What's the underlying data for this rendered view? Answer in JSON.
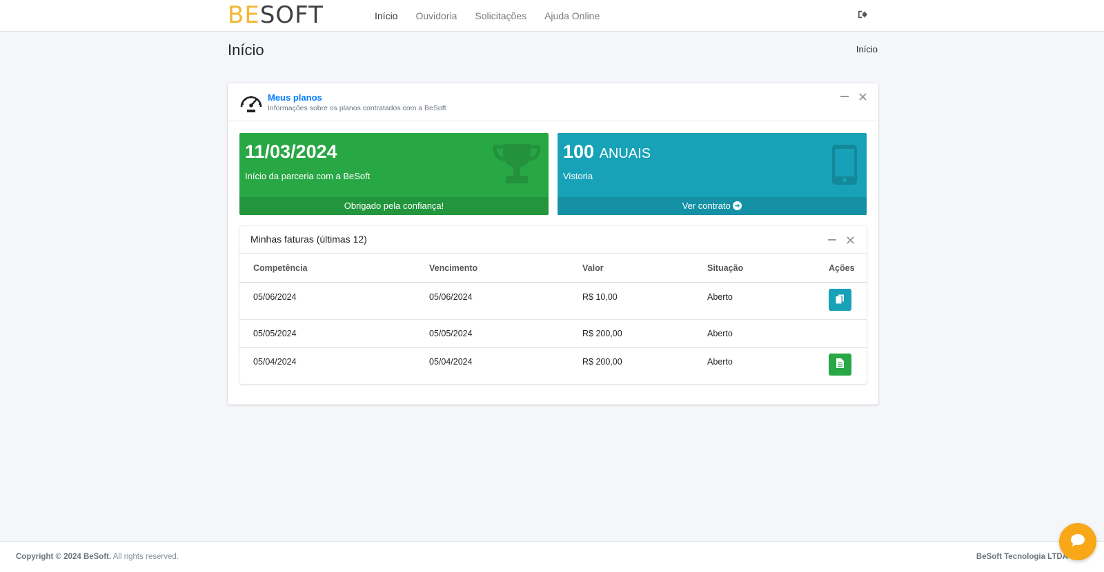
{
  "brand": {
    "logo_part1": "BE",
    "logo_part2": "SOFT"
  },
  "nav": {
    "items": [
      {
        "label": "Início",
        "active": true
      },
      {
        "label": "Ouvidoria",
        "active": false
      },
      {
        "label": "Solicitações",
        "active": false
      },
      {
        "label": "Ajuda Online",
        "active": false
      }
    ],
    "logout_icon": "sign-out-icon"
  },
  "header": {
    "title": "Início",
    "breadcrumb": "Início"
  },
  "plans_card": {
    "title": "Meus planos",
    "subtitle": "Informações sobre os planos contratados com a BeSoft",
    "icon": "speedometer-icon"
  },
  "boxes": {
    "start": {
      "value": "11/03/2024",
      "description": "Início da parceria com a BeSoft",
      "footer": "Obrigado pela confiança!",
      "icon": "trophy-icon",
      "color": "#28a745"
    },
    "plan": {
      "value": "100",
      "value_suffix": "ANUAIS",
      "description": "Vistoria",
      "footer": "Ver contrato",
      "icon": "mobile-icon",
      "color": "#17a2b8"
    }
  },
  "invoices": {
    "title": "Minhas faturas (últimas 12)",
    "columns": [
      "Competência",
      "Vencimento",
      "Valor",
      "Situação",
      "Ações"
    ],
    "rows": [
      {
        "competencia": "05/06/2024",
        "vencimento": "05/06/2024",
        "valor": "R$ 10,00",
        "situacao": "Aberto",
        "action": "copy-icon"
      },
      {
        "competencia": "05/05/2024",
        "vencimento": "05/05/2024",
        "valor": "R$ 200,00",
        "situacao": "Aberto",
        "action": ""
      },
      {
        "competencia": "05/04/2024",
        "vencimento": "05/04/2024",
        "valor": "R$ 200,00",
        "situacao": "Aberto",
        "action": "file-icon"
      }
    ]
  },
  "footer": {
    "copyright_bold": "Copyright © 2024 BeSoft.",
    "copyright_rest": "All rights reserved.",
    "company": "BeSoft Tecnologia LTDA"
  },
  "chat_icon": "chat-bubble-icon",
  "colors": {
    "accent": "#007bff",
    "success": "#28a745",
    "info": "#17a2b8",
    "chat": "#f8a717"
  }
}
